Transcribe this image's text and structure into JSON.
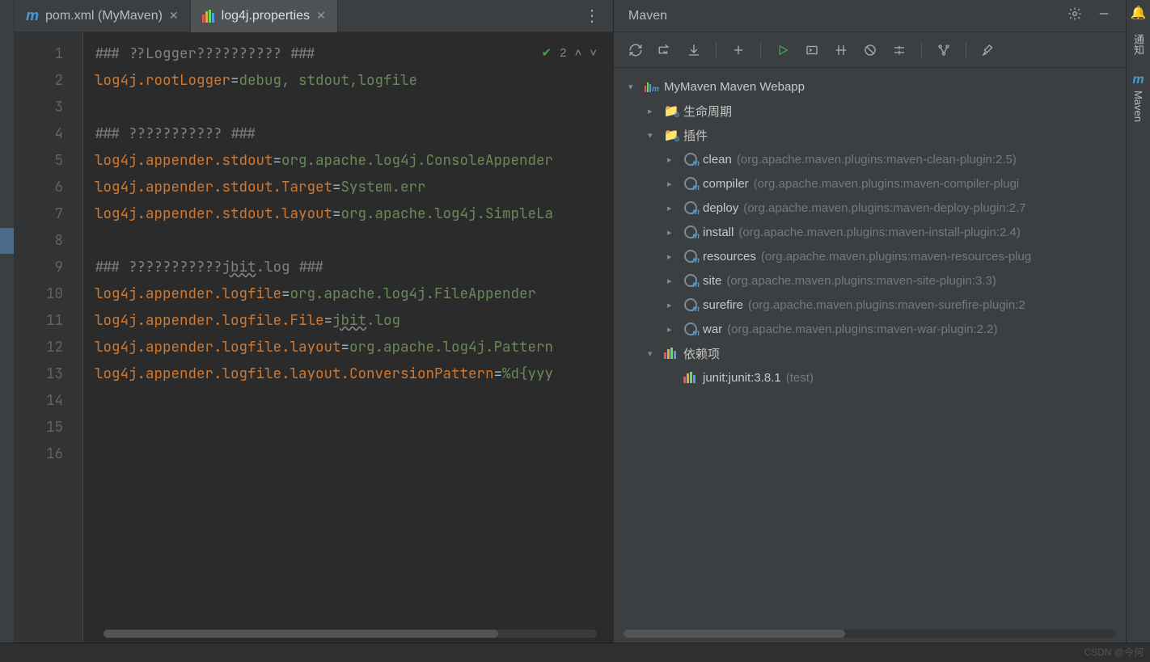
{
  "tabs": [
    {
      "label": "pom.xml (MyMaven)",
      "active": false
    },
    {
      "label": "log4j.properties",
      "active": true
    }
  ],
  "inspection": {
    "count": "2"
  },
  "code": {
    "lines": [
      {
        "n": "1",
        "seg": [
          {
            "c": "kw-comment",
            "t": "### ??Logger?????????? ###"
          }
        ]
      },
      {
        "n": "2",
        "seg": [
          {
            "c": "kw-key",
            "t": "log4j.rootLogger"
          },
          {
            "c": "kw-eq",
            "t": "="
          },
          {
            "c": "kw-val",
            "t": "debug, stdout,logfile"
          }
        ]
      },
      {
        "n": "3",
        "seg": []
      },
      {
        "n": "4",
        "seg": [
          {
            "c": "kw-comment",
            "t": "### ??????????? ###"
          }
        ]
      },
      {
        "n": "5",
        "seg": [
          {
            "c": "kw-key",
            "t": "log4j.appender.stdout"
          },
          {
            "c": "kw-eq",
            "t": "="
          },
          {
            "c": "kw-val",
            "t": "org.apache.log4j.ConsoleAppender"
          }
        ]
      },
      {
        "n": "6",
        "seg": [
          {
            "c": "kw-key",
            "t": "log4j.appender.stdout.Target"
          },
          {
            "c": "kw-eq",
            "t": "="
          },
          {
            "c": "kw-val",
            "t": "System.err"
          }
        ]
      },
      {
        "n": "7",
        "seg": [
          {
            "c": "kw-key",
            "t": "log4j.appender.stdout.layout"
          },
          {
            "c": "kw-eq",
            "t": "="
          },
          {
            "c": "kw-val",
            "t": "org.apache.log4j.SimpleLa"
          }
        ]
      },
      {
        "n": "8",
        "seg": []
      },
      {
        "n": "9",
        "seg": [
          {
            "c": "kw-comment",
            "t": "### ???????????"
          },
          {
            "c": "kw-comment underline",
            "t": "jbit"
          },
          {
            "c": "kw-comment",
            "t": ".log ###"
          }
        ]
      },
      {
        "n": "10",
        "seg": [
          {
            "c": "kw-key",
            "t": "log4j.appender.logfile"
          },
          {
            "c": "kw-eq",
            "t": "="
          },
          {
            "c": "kw-val",
            "t": "org.apache.log4j.FileAppender"
          }
        ]
      },
      {
        "n": "11",
        "seg": [
          {
            "c": "kw-key",
            "t": "log4j.appender.logfile.File"
          },
          {
            "c": "kw-eq",
            "t": "="
          },
          {
            "c": "kw-val underline",
            "t": "jbit"
          },
          {
            "c": "kw-val",
            "t": ".log"
          }
        ]
      },
      {
        "n": "12",
        "seg": [
          {
            "c": "kw-key",
            "t": "log4j.appender.logfile.layout"
          },
          {
            "c": "kw-eq",
            "t": "="
          },
          {
            "c": "kw-val",
            "t": "org.apache.log4j.Pattern"
          }
        ]
      },
      {
        "n": "13",
        "seg": [
          {
            "c": "kw-key",
            "t": "log4j.appender.logfile.layout.ConversionPattern"
          },
          {
            "c": "kw-eq",
            "t": "="
          },
          {
            "c": "kw-val",
            "t": "%d{yyy"
          }
        ]
      },
      {
        "n": "14",
        "seg": []
      },
      {
        "n": "15",
        "seg": []
      },
      {
        "n": "16",
        "seg": []
      }
    ]
  },
  "maven": {
    "title": "Maven",
    "project": "MyMaven Maven Webapp",
    "lifecycle": "生命周期",
    "pluginsLabel": "插件",
    "plugins": [
      {
        "name": "clean",
        "desc": "(org.apache.maven.plugins:maven-clean-plugin:2.5)"
      },
      {
        "name": "compiler",
        "desc": "(org.apache.maven.plugins:maven-compiler-plugi"
      },
      {
        "name": "deploy",
        "desc": "(org.apache.maven.plugins:maven-deploy-plugin:2.7"
      },
      {
        "name": "install",
        "desc": "(org.apache.maven.plugins:maven-install-plugin:2.4)"
      },
      {
        "name": "resources",
        "desc": "(org.apache.maven.plugins:maven-resources-plug"
      },
      {
        "name": "site",
        "desc": "(org.apache.maven.plugins:maven-site-plugin:3.3)"
      },
      {
        "name": "surefire",
        "desc": "(org.apache.maven.plugins:maven-surefire-plugin:2"
      },
      {
        "name": "war",
        "desc": "(org.apache.maven.plugins:maven-war-plugin:2.2)"
      }
    ],
    "dependenciesLabel": "依赖项",
    "dependencies": [
      {
        "name": "junit:junit:3.8.1",
        "scope": "(test)"
      }
    ]
  },
  "sideLabels": {
    "notify": "通知",
    "maven": "Maven"
  },
  "watermark": "CSDN @今何"
}
